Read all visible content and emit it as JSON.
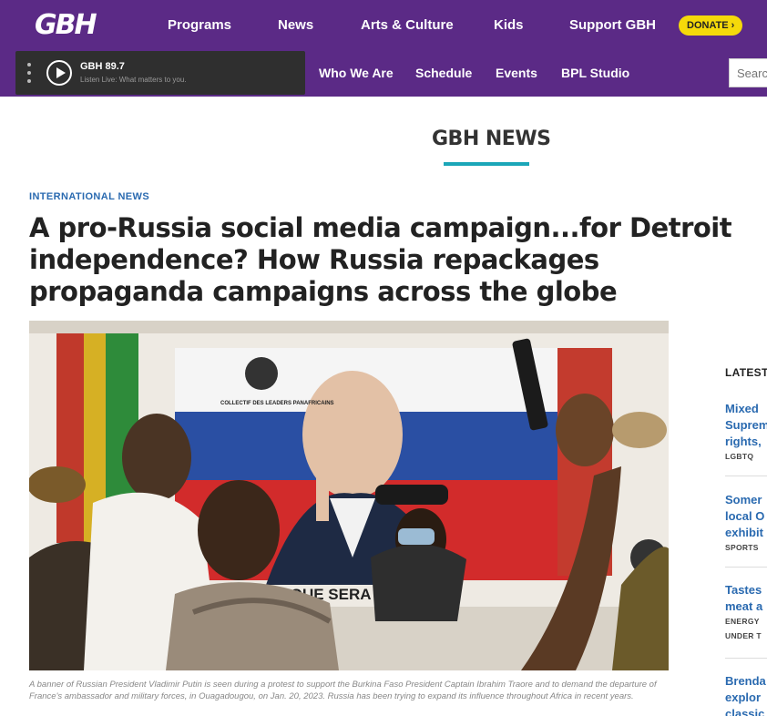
{
  "brand": {
    "logo_text": "GBH",
    "accent": "#5b2a86",
    "highlight": "#1ba6b8"
  },
  "main_nav": [
    "Programs",
    "News",
    "Arts & Culture",
    "Kids",
    "Support GBH"
  ],
  "donate_label": "DONATE",
  "player": {
    "station": "GBH 89.7",
    "tagline": "Listen Live: What matters to you."
  },
  "sub_nav": [
    "Who We Are",
    "Schedule",
    "Events",
    "BPL Studio"
  ],
  "search": {
    "placeholder": "Search"
  },
  "section": {
    "title": "GBH NEWS"
  },
  "article": {
    "category": "INTERNATIONAL NEWS",
    "headline": "A pro-Russia social media campaign...for Detroit independence? How Russia repackages propaganda campaigns across the globe",
    "banner_text": "IQUE SERA",
    "banner_logo": "COLLECTIF DES LEADERS PANAFRICAINS",
    "caption": "A banner of Russian President Vladimir Putin is seen during a protest to support the Burkina Faso President Captain Ibrahim Traore and to demand the departure of France's ambassador and military forces, in Ouagadougou, on Jan. 20, 2023. Russia has been trying to expand its influence throughout Africa in recent years."
  },
  "rail": {
    "heading": "LATEST",
    "items": [
      {
        "title_lines": [
          "Mixed",
          "Suprem",
          "rights,"
        ],
        "tags": [
          "LGBTQ"
        ]
      },
      {
        "title_lines": [
          "Somer",
          "local O",
          "exhibit"
        ],
        "tags": [
          "SPORTS"
        ]
      },
      {
        "title_lines": [
          "Tastes",
          "meat a"
        ],
        "tags": [
          "ENERGY",
          "UNDER T"
        ]
      },
      {
        "title_lines": [
          "Brenda",
          "explor",
          "classic"
        ],
        "tags": []
      }
    ]
  }
}
